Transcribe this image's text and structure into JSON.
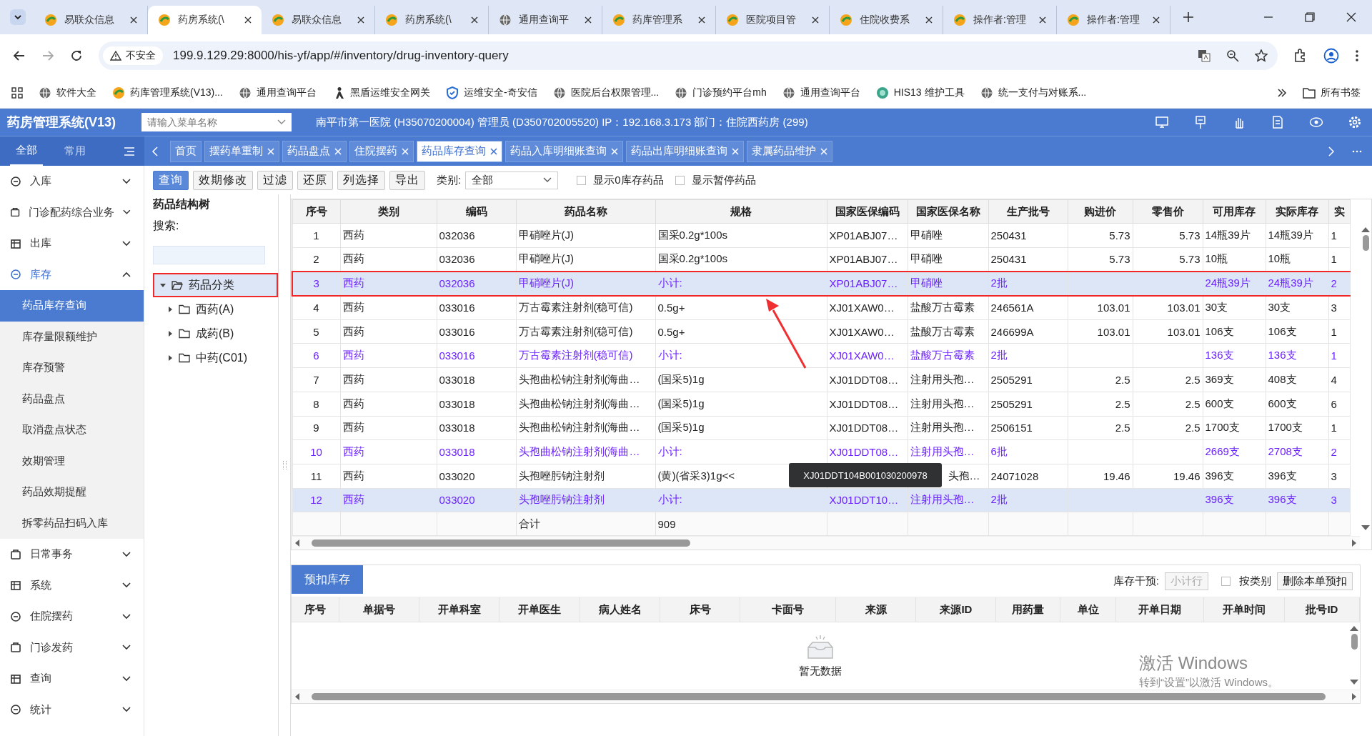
{
  "browser": {
    "tabs": [
      {
        "title": "易联众信息",
        "selected": false
      },
      {
        "title": "药房系统(\\",
        "selected": true
      },
      {
        "title": "易联众信息",
        "selected": false
      },
      {
        "title": "药房系统(\\",
        "selected": false
      },
      {
        "title": "通用查询平",
        "selected": false
      },
      {
        "title": "药库管理系",
        "selected": false
      },
      {
        "title": "医院项目管",
        "selected": false
      },
      {
        "title": "住院收费系",
        "selected": false
      },
      {
        "title": "操作者:管理",
        "selected": false
      },
      {
        "title": "操作者:管理",
        "selected": false
      }
    ],
    "security": "不安全",
    "url": "199.9.129.29:8000/his-yf/app/#/inventory/drug-inventory-query",
    "bookmarks": [
      {
        "title": "软件大全"
      },
      {
        "title": "药库管理系统(V13)..."
      },
      {
        "title": "通用查询平台"
      },
      {
        "title": "黑盾运维安全网关"
      },
      {
        "title": "运维安全-奇安信"
      },
      {
        "title": "医院后台权限管理..."
      },
      {
        "title": "门诊预约平台mh"
      },
      {
        "title": "通用查询平台"
      },
      {
        "title": "HIS13 维护工具"
      },
      {
        "title": "统一支付与对账系..."
      }
    ],
    "all_bookmarks": "所有书签"
  },
  "app": {
    "title": "药房管理系统(V13)",
    "menu_search": {
      "placeholder": "请输入菜单名称"
    },
    "info": "南平市第一医院 (H35070200004) 管理员 (D350702005520) IP：192.168.3.173 部门：住院西药房 (299)"
  },
  "sidebar": {
    "tabs": [
      {
        "label": "全部",
        "selected": true
      },
      {
        "label": "常用",
        "selected": false
      }
    ],
    "items": [
      {
        "label": "入库",
        "selected": false,
        "expanded": false
      },
      {
        "label": "门诊配药综合业务",
        "selected": false,
        "expanded": false
      },
      {
        "label": "出库",
        "selected": false,
        "expanded": false
      },
      {
        "label": "库存",
        "selected": true,
        "expanded": true,
        "children": [
          {
            "label": "药品库存查询",
            "selected": true
          },
          {
            "label": "库存量限额维护",
            "selected": false
          },
          {
            "label": "库存预警",
            "selected": false
          },
          {
            "label": "药品盘点",
            "selected": false
          },
          {
            "label": "取消盘点状态",
            "selected": false
          },
          {
            "label": "效期管理",
            "selected": false
          },
          {
            "label": "药品效期提醒",
            "selected": false
          },
          {
            "label": "拆零药品扫码入库",
            "selected": false
          }
        ]
      },
      {
        "label": "日常事务",
        "selected": false,
        "expanded": false
      },
      {
        "label": "系统",
        "selected": false,
        "expanded": false
      },
      {
        "label": "住院摆药",
        "selected": false,
        "expanded": false
      },
      {
        "label": "门诊发药",
        "selected": false,
        "expanded": false
      },
      {
        "label": "查询",
        "selected": false,
        "expanded": false
      },
      {
        "label": "统计",
        "selected": false,
        "expanded": false
      }
    ]
  },
  "page_tabs": [
    {
      "label": "首页",
      "closable": false,
      "selected": false
    },
    {
      "label": "摆药单重制",
      "closable": true,
      "selected": false
    },
    {
      "label": "药品盘点",
      "closable": true,
      "selected": false
    },
    {
      "label": "住院摆药",
      "closable": true,
      "selected": false
    },
    {
      "label": "药品库存查询",
      "closable": true,
      "selected": true
    },
    {
      "label": "药品入库明细账查询",
      "closable": true,
      "selected": false
    },
    {
      "label": "药品出库明细账查询",
      "closable": true,
      "selected": false
    },
    {
      "label": "隶属药品维护",
      "closable": true,
      "selected": false
    }
  ],
  "toolbar": {
    "buttons": [
      {
        "label": "查询",
        "primary": true
      },
      {
        "label": "效期修改",
        "primary": false
      },
      {
        "label": "过滤",
        "primary": false
      },
      {
        "label": "还原",
        "primary": false
      },
      {
        "label": "列选择",
        "primary": false
      },
      {
        "label": "导出",
        "primary": false
      }
    ],
    "category": {
      "label": "类别:",
      "value": "全部"
    },
    "checkboxes": [
      {
        "label": "显示0库存药品",
        "checked": false
      },
      {
        "label": "显示暂停药品",
        "checked": false
      }
    ]
  },
  "tree": {
    "title": "药品结构树",
    "search_label": "搜索:",
    "root": {
      "label": "药品分类",
      "expanded": true,
      "selected": true,
      "highlighted": true,
      "children": [
        {
          "label": "西药(A)",
          "expanded": false
        },
        {
          "label": "成药(B)",
          "expanded": false
        },
        {
          "label": "中药(C01)",
          "expanded": false
        }
      ]
    }
  },
  "table": {
    "columns": [
      "序号",
      "类别",
      "编码",
      "药品名称",
      "规格",
      "国家医保编码",
      "国家医保名称",
      "生产批号",
      "购进价",
      "零售价",
      "可用库存",
      "实际库存",
      "实"
    ],
    "rows": [
      {
        "kind": "item",
        "selected": false,
        "highlighted": false,
        "no": "1",
        "category": "西药",
        "code": "032036",
        "name": "甲硝唑片(J)",
        "spec": "国采0.2g*100s",
        "yb_code": "XP01ABJ07…",
        "yb_name": "甲硝唑",
        "batch": "250431",
        "buy_price": "5.73",
        "retail_price": "5.73",
        "available": "14瓶39片",
        "actual": "14瓶39片",
        "column_13": "1"
      },
      {
        "kind": "item",
        "selected": false,
        "highlighted": false,
        "no": "2",
        "category": "西药",
        "code": "032036",
        "name": "甲硝唑片(J)",
        "spec": "国采0.2g*100s",
        "yb_code": "XP01ABJ07…",
        "yb_name": "甲硝唑",
        "batch": "250431",
        "buy_price": "5.73",
        "retail_price": "5.73",
        "available": "10瓶",
        "actual": "10瓶",
        "column_13": "1"
      },
      {
        "kind": "subtotal",
        "selected": true,
        "highlighted": true,
        "no": "3",
        "category": "西药",
        "code": "032036",
        "name": "甲硝唑片(J)",
        "spec": "小计:",
        "yb_code": "XP01ABJ07…",
        "yb_name": "甲硝唑",
        "batch": "2批",
        "available": "24瓶39片",
        "actual": "24瓶39片",
        "column_13": "2"
      },
      {
        "kind": "item",
        "selected": false,
        "highlighted": false,
        "no": "4",
        "category": "西药",
        "code": "033016",
        "name": "万古霉素注射剂(稳可信)",
        "spec": "0.5g+",
        "yb_code": "XJ01XAW0…",
        "yb_name": "盐酸万古霉素",
        "batch": "246561A",
        "buy_price": "103.01",
        "retail_price": "103.01",
        "available": "30支",
        "actual": "30支",
        "column_13": "3"
      },
      {
        "kind": "item",
        "selected": false,
        "highlighted": false,
        "no": "5",
        "category": "西药",
        "code": "033016",
        "name": "万古霉素注射剂(稳可信)",
        "spec": "0.5g+",
        "yb_code": "XJ01XAW0…",
        "yb_name": "盐酸万古霉素",
        "batch": "246699A",
        "buy_price": "103.01",
        "retail_price": "103.01",
        "available": "106支",
        "actual": "106支",
        "column_13": "1"
      },
      {
        "kind": "subtotal",
        "selected": false,
        "highlighted": false,
        "no": "6",
        "category": "西药",
        "code": "033016",
        "name": "万古霉素注射剂(稳可信)",
        "spec": "小计:",
        "yb_code": "XJ01XAW0…",
        "yb_name": "盐酸万古霉素",
        "batch": "2批",
        "available": "136支",
        "actual": "136支",
        "column_13": "1"
      },
      {
        "kind": "item",
        "selected": false,
        "highlighted": false,
        "no": "7",
        "category": "西药",
        "code": "033018",
        "name": "头孢曲松钠注射剂(海曲…",
        "spec": "(国采5)1g",
        "yb_code": "XJ01DDT08…",
        "yb_name": "注射用头孢…",
        "batch": "2505291",
        "buy_price": "2.5",
        "retail_price": "2.5",
        "available": "369支",
        "actual": "408支",
        "column_13": "4"
      },
      {
        "kind": "item",
        "selected": false,
        "highlighted": false,
        "no": "8",
        "category": "西药",
        "code": "033018",
        "name": "头孢曲松钠注射剂(海曲…",
        "spec": "(国采5)1g",
        "yb_code": "XJ01DDT08…",
        "yb_name": "注射用头孢…",
        "batch": "2505291",
        "buy_price": "2.5",
        "retail_price": "2.5",
        "available": "600支",
        "actual": "600支",
        "column_13": "6"
      },
      {
        "kind": "item",
        "selected": false,
        "highlighted": false,
        "no": "9",
        "category": "西药",
        "code": "033018",
        "name": "头孢曲松钠注射剂(海曲…",
        "spec": "(国采5)1g",
        "yb_code": "XJ01DDT08…",
        "yb_name": "注射用头孢…",
        "batch": "2506151",
        "buy_price": "2.5",
        "retail_price": "2.5",
        "available": "1700支",
        "actual": "1700支",
        "column_13": "1"
      },
      {
        "kind": "subtotal",
        "selected": false,
        "highlighted": false,
        "no": "10",
        "category": "西药",
        "code": "033018",
        "name": "头孢曲松钠注射剂(海曲…",
        "spec": "小计:",
        "yb_code": "XJ01DDT08…",
        "yb_name": "注射用头孢…",
        "batch": "6批",
        "available": "2669支",
        "actual": "2708支",
        "column_13": "2"
      },
      {
        "kind": "item",
        "selected": false,
        "highlighted": false,
        "no": "11",
        "category": "西药",
        "code": "033020",
        "name": "头孢唑肟钠注射剂",
        "spec": "(黄)(省采3)1g<<",
        "yb_name": "头孢…",
        "batch": "24071028",
        "buy_price": "19.46",
        "retail_price": "19.46",
        "available": "396支",
        "actual": "396支",
        "column_13": "3"
      },
      {
        "kind": "subtotal",
        "selected": true,
        "highlighted": false,
        "no": "12",
        "category": "西药",
        "code": "033020",
        "name": "头孢唑肟钠注射剂",
        "spec": "小计:",
        "yb_code": "XJ01DDT10…",
        "yb_name": "注射用头孢…",
        "batch": "2批",
        "available": "396支",
        "actual": "396支",
        "column_13": "3",
        "tooltip": "XJ01DDT104B001030200978"
      }
    ],
    "total": {
      "label": "合计",
      "value": "909"
    }
  },
  "reserve": {
    "button": "预扣库存",
    "intervene_label": "库存干预:",
    "subtotal_button": {
      "label": "小计行",
      "disabled": true
    },
    "by_category": {
      "label": "按类别",
      "checked": false
    },
    "delete_button": "删除本单预扣",
    "columns": [
      "序号",
      "单据号",
      "开单科室",
      "开单医生",
      "病人姓名",
      "床号",
      "卡面号",
      "来源",
      "来源ID",
      "用药量",
      "单位",
      "开单日期",
      "开单时间",
      "批号ID"
    ],
    "empty_text": "暂无数据"
  },
  "os_notice": {
    "title": "激活 Windows",
    "text": "转到“设置”以激活 Windows。"
  }
}
